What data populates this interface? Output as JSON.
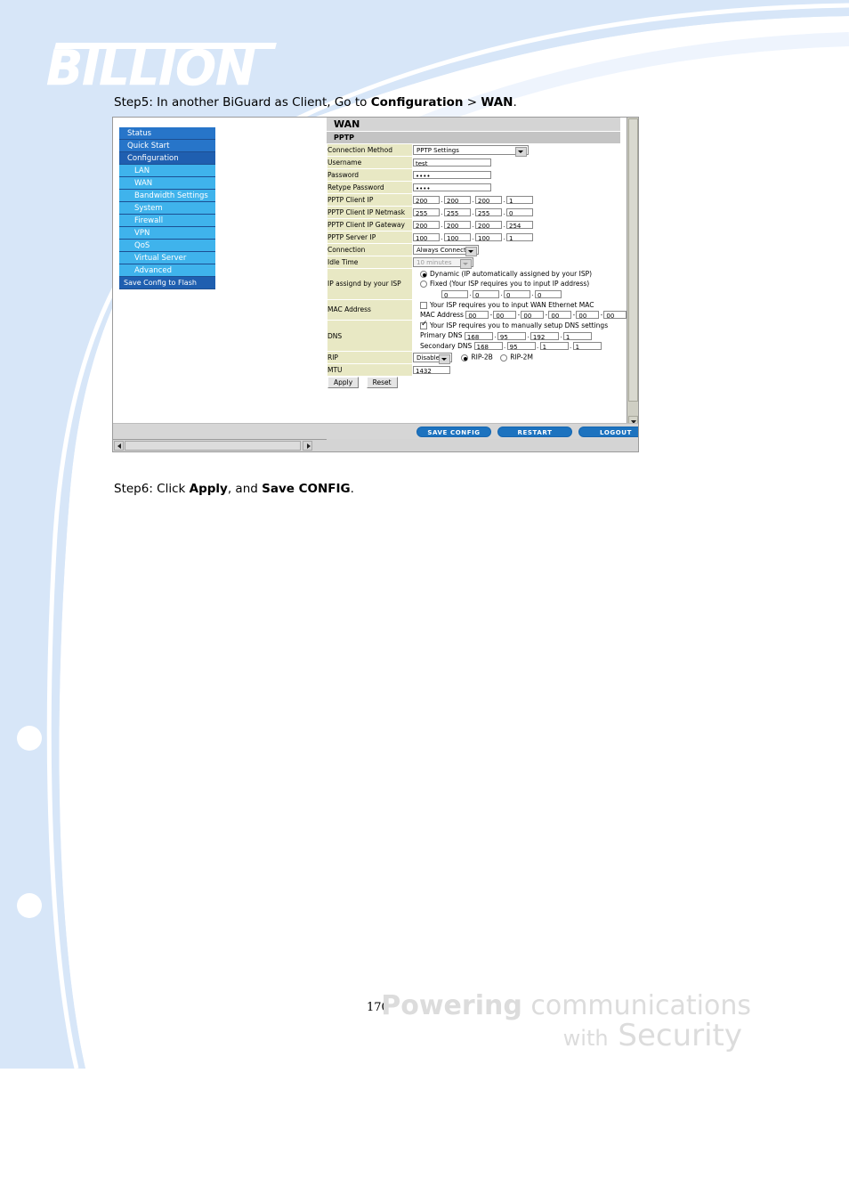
{
  "document": {
    "brand": "BILLION",
    "page_number": "170",
    "tagline_line1_bold": "Powering",
    "tagline_line1_light": "communications",
    "tagline_line2_light": "with",
    "tagline_line2_bold": "Security",
    "step5": {
      "prefix": "Step5: In another BiGuard as Client, Go to ",
      "bold1": "Configuration",
      "middle": " > ",
      "bold2": "WAN",
      "suffix": "."
    },
    "step6": {
      "prefix": "Step6: Click ",
      "bold1": "Apply",
      "middle": ", and ",
      "bold2": "Save CONFIG",
      "suffix": "."
    }
  },
  "router_ui": {
    "sidebar": [
      {
        "label": "Status",
        "type": "top"
      },
      {
        "label": "Quick Start",
        "type": "top"
      },
      {
        "label": "Configuration",
        "type": "current"
      },
      {
        "label": "LAN",
        "type": "sub"
      },
      {
        "label": "WAN",
        "type": "sub"
      },
      {
        "label": "Bandwidth Settings",
        "type": "sub"
      },
      {
        "label": "System",
        "type": "sub"
      },
      {
        "label": "Firewall",
        "type": "sub"
      },
      {
        "label": "VPN",
        "type": "sub"
      },
      {
        "label": "QoS",
        "type": "sub"
      },
      {
        "label": "Virtual Server",
        "type": "sub"
      },
      {
        "label": "Advanced",
        "type": "sub"
      },
      {
        "label": "Save Config to Flash",
        "type": "foot"
      }
    ],
    "panel": {
      "title": "WAN",
      "section": "PPTP"
    },
    "fields": {
      "connection_method": {
        "label": "Connection Method",
        "value": "PPTP Settings"
      },
      "username": {
        "label": "Username",
        "value": "test"
      },
      "password": {
        "label": "Password",
        "value": "••••"
      },
      "retype_password": {
        "label": "Retype Password",
        "value": "••••"
      },
      "pptp_client_ip": {
        "label": "PPTP Client IP",
        "octets": [
          "200",
          "200",
          "200",
          "1"
        ]
      },
      "pptp_client_netmask": {
        "label": "PPTP Client IP Netmask",
        "octets": [
          "255",
          "255",
          "255",
          "0"
        ]
      },
      "pptp_client_gateway": {
        "label": "PPTP Client IP Gateway",
        "octets": [
          "200",
          "200",
          "200",
          "254"
        ]
      },
      "pptp_server_ip": {
        "label": "PPTP Server IP",
        "octets": [
          "100",
          "100",
          "100",
          "1"
        ]
      },
      "connection": {
        "label": "Connection",
        "value": "Always Connect"
      },
      "idle_time": {
        "label": "Idle Time",
        "value": "10 minutes",
        "disabled": true
      },
      "ip_assign": {
        "label": "IP assignd by your ISP",
        "dynamic_label": "Dynamic (IP automatically assigned by your ISP)",
        "dynamic_selected": true,
        "fixed_label": "Fixed (Your ISP requires you to input IP address)",
        "fixed_selected": false,
        "fixed_octets": [
          "0",
          "0",
          "0",
          "0"
        ]
      },
      "mac_address": {
        "label": "MAC Address",
        "checkbox_label": "Your ISP requires you to input WAN Ethernet MAC",
        "checked": false,
        "field_label": "MAC Address",
        "bytes": [
          "00",
          "00",
          "00",
          "00",
          "00",
          "00"
        ]
      },
      "dns": {
        "label": "DNS",
        "checkbox_label": "Your ISP requires you to manually setup DNS settings",
        "checked": true,
        "primary_label": "Primary DNS",
        "primary_octets": [
          "168",
          "95",
          "192",
          "1"
        ],
        "secondary_label": "Secondary DNS",
        "secondary_octets": [
          "168",
          "95",
          "1",
          "1"
        ]
      },
      "rip": {
        "label": "RIP",
        "select_value": "Disable",
        "radio1_label": "RIP-2B",
        "radio1_selected": true,
        "radio2_label": "RIP-2M",
        "radio2_selected": false
      },
      "mtu": {
        "label": "MTU",
        "value": "1432"
      }
    },
    "form_buttons": {
      "apply": "Apply",
      "reset": "Reset"
    },
    "action_buttons": {
      "save_config": "SAVE CONFIG",
      "restart": "RESTART",
      "logout": "LOGOUT"
    }
  },
  "colors": {
    "nav_top": "#2775c9",
    "nav_sub": "#3fb3ec",
    "nav_current": "#1f5fb0",
    "label_cell": "#e8e8c4",
    "action_pill": "#1d73bf",
    "page_accent": "#cfe0f5"
  }
}
